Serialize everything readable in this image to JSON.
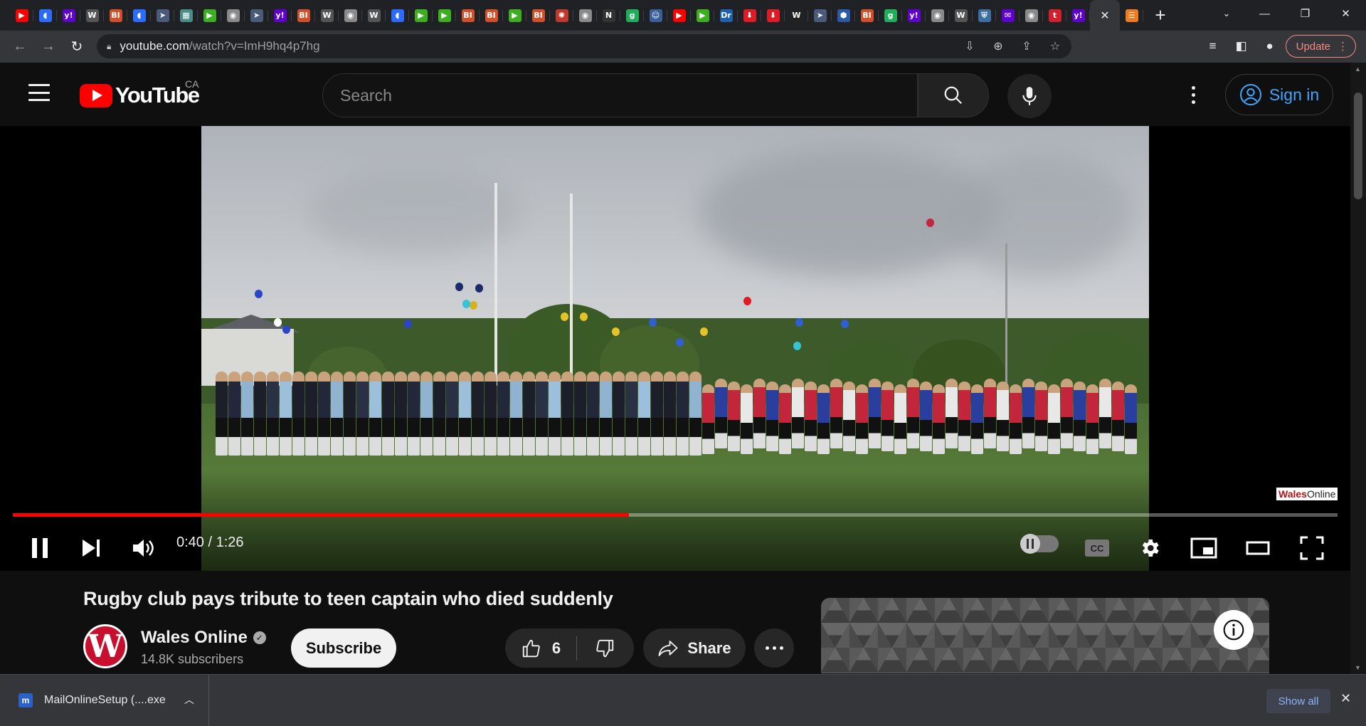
{
  "browser": {
    "tabs": [
      {
        "icon": "youtube-icon",
        "glyph": "▶",
        "color": "#ff0000"
      },
      {
        "icon": "shield-icon",
        "glyph": "◖",
        "color": "#2a6cff"
      },
      {
        "icon": "yahoo-icon",
        "glyph": "y!",
        "color": "#6001d2"
      },
      {
        "icon": "wsj-icon",
        "glyph": "W",
        "color": "#555555"
      },
      {
        "icon": "business-insider-icon",
        "glyph": "BI",
        "color": "#d24f2a"
      },
      {
        "icon": "shield-icon",
        "glyph": "◖",
        "color": "#2a6cff"
      },
      {
        "icon": "arrow-tag-icon",
        "glyph": "➤",
        "color": "#4a5a7a"
      },
      {
        "icon": "map-icon",
        "glyph": "▦",
        "color": "#4a8c8a"
      },
      {
        "icon": "play-circle-icon",
        "glyph": "▶",
        "color": "#3caf1e"
      },
      {
        "icon": "globe-icon",
        "glyph": "◉",
        "color": "#8a8a8a"
      },
      {
        "icon": "arrow-tag-icon",
        "glyph": "➤",
        "color": "#4a5a7a"
      },
      {
        "icon": "yahoo-icon",
        "glyph": "y!",
        "color": "#6001d2"
      },
      {
        "icon": "business-insider-icon",
        "glyph": "BI",
        "color": "#d24f2a"
      },
      {
        "icon": "wsj-icon",
        "glyph": "W",
        "color": "#555555"
      },
      {
        "icon": "globe-icon",
        "glyph": "◉",
        "color": "#8a8a8a"
      },
      {
        "icon": "wsj-icon",
        "glyph": "W",
        "color": "#555555"
      },
      {
        "icon": "shield-icon",
        "glyph": "◖",
        "color": "#2a6cff"
      },
      {
        "icon": "play-circle-icon",
        "glyph": "▶",
        "color": "#3caf1e"
      },
      {
        "icon": "play-circle-icon",
        "glyph": "▶",
        "color": "#3caf1e"
      },
      {
        "icon": "business-insider-icon",
        "glyph": "BI",
        "color": "#d24f2a"
      },
      {
        "icon": "business-insider-icon",
        "glyph": "BI",
        "color": "#d24f2a"
      },
      {
        "icon": "play-circle-icon",
        "glyph": "▶",
        "color": "#3caf1e"
      },
      {
        "icon": "business-insider-icon",
        "glyph": "BI",
        "color": "#d24f2a"
      },
      {
        "icon": "starburst-icon",
        "glyph": "✺",
        "color": "#c0392b"
      },
      {
        "icon": "globe-icon",
        "glyph": "◉",
        "color": "#8a8a8a"
      },
      {
        "icon": "newspaper-icon",
        "glyph": "N",
        "color": "#333333"
      },
      {
        "icon": "g-icon",
        "glyph": "g",
        "color": "#1fae5a"
      },
      {
        "icon": "portrait-icon",
        "glyph": "☺",
        "color": "#3a5f9a"
      },
      {
        "icon": "youtube-icon",
        "glyph": "▶",
        "color": "#ff0000"
      },
      {
        "icon": "play-circle-icon",
        "glyph": "▶",
        "color": "#3caf1e"
      },
      {
        "icon": "dr-icon",
        "glyph": "Dr",
        "color": "#1d5fb0"
      },
      {
        "icon": "download-red-icon",
        "glyph": "⬇",
        "color": "#e01b24"
      },
      {
        "icon": "download-red-icon",
        "glyph": "⬇",
        "color": "#e01b24"
      },
      {
        "icon": "wp-icon",
        "glyph": "W",
        "color": "#222222"
      },
      {
        "icon": "arrow-tag-icon",
        "glyph": "➤",
        "color": "#4a5a7a"
      },
      {
        "icon": "cube-icon",
        "glyph": "⬢",
        "color": "#2d5aa8"
      },
      {
        "icon": "business-insider-icon",
        "glyph": "BI",
        "color": "#d24f2a"
      },
      {
        "icon": "g-icon",
        "glyph": "g",
        "color": "#1fae5a"
      },
      {
        "icon": "yahoo-icon",
        "glyph": "y!",
        "color": "#6001d2"
      },
      {
        "icon": "globe-icon",
        "glyph": "◉",
        "color": "#8a8a8a"
      },
      {
        "icon": "wsj-icon",
        "glyph": "W",
        "color": "#555555"
      },
      {
        "icon": "crest-icon",
        "glyph": "⛨",
        "color": "#3a6ea5"
      },
      {
        "icon": "yahoo-mail-icon",
        "glyph": "✉",
        "color": "#6001d2"
      },
      {
        "icon": "globe-icon",
        "glyph": "◉",
        "color": "#8a8a8a"
      },
      {
        "icon": "red-t-icon",
        "glyph": "t",
        "color": "#d3202a"
      },
      {
        "icon": "yahoo-icon",
        "glyph": "y!",
        "color": "#6001d2"
      }
    ],
    "new_tab_tab_icon": {
      "icon": "bookmark-stack-icon",
      "glyph": "☰",
      "color": "#f07b1f"
    },
    "url_host": "youtube.com",
    "url_path": "/watch?v=ImH9hq4p7hg",
    "update_label": "Update"
  },
  "masthead": {
    "logo_text": "YouTube",
    "country_code": "CA",
    "search_placeholder": "Search",
    "signin_label": "Sign in"
  },
  "player": {
    "current_time": "0:40",
    "duration": "1:26",
    "progress_fraction": 0.4651,
    "watermark_bold": "Wales",
    "watermark_rest": "Online"
  },
  "video": {
    "title": "Rugby club pays tribute to teen captain who died suddenly",
    "channel_name": "Wales Online",
    "channel_initial": "W",
    "subscribers": "14.8K subscribers",
    "subscribe_label": "Subscribe",
    "likes": "6",
    "share_label": "Share"
  },
  "downloads": {
    "file_name": "MailOnlineSetup (....exe",
    "show_all_label": "Show all"
  },
  "colors": {
    "accent": "#ff0000",
    "link": "#3ea6ff",
    "background": "#0f0f0f"
  }
}
